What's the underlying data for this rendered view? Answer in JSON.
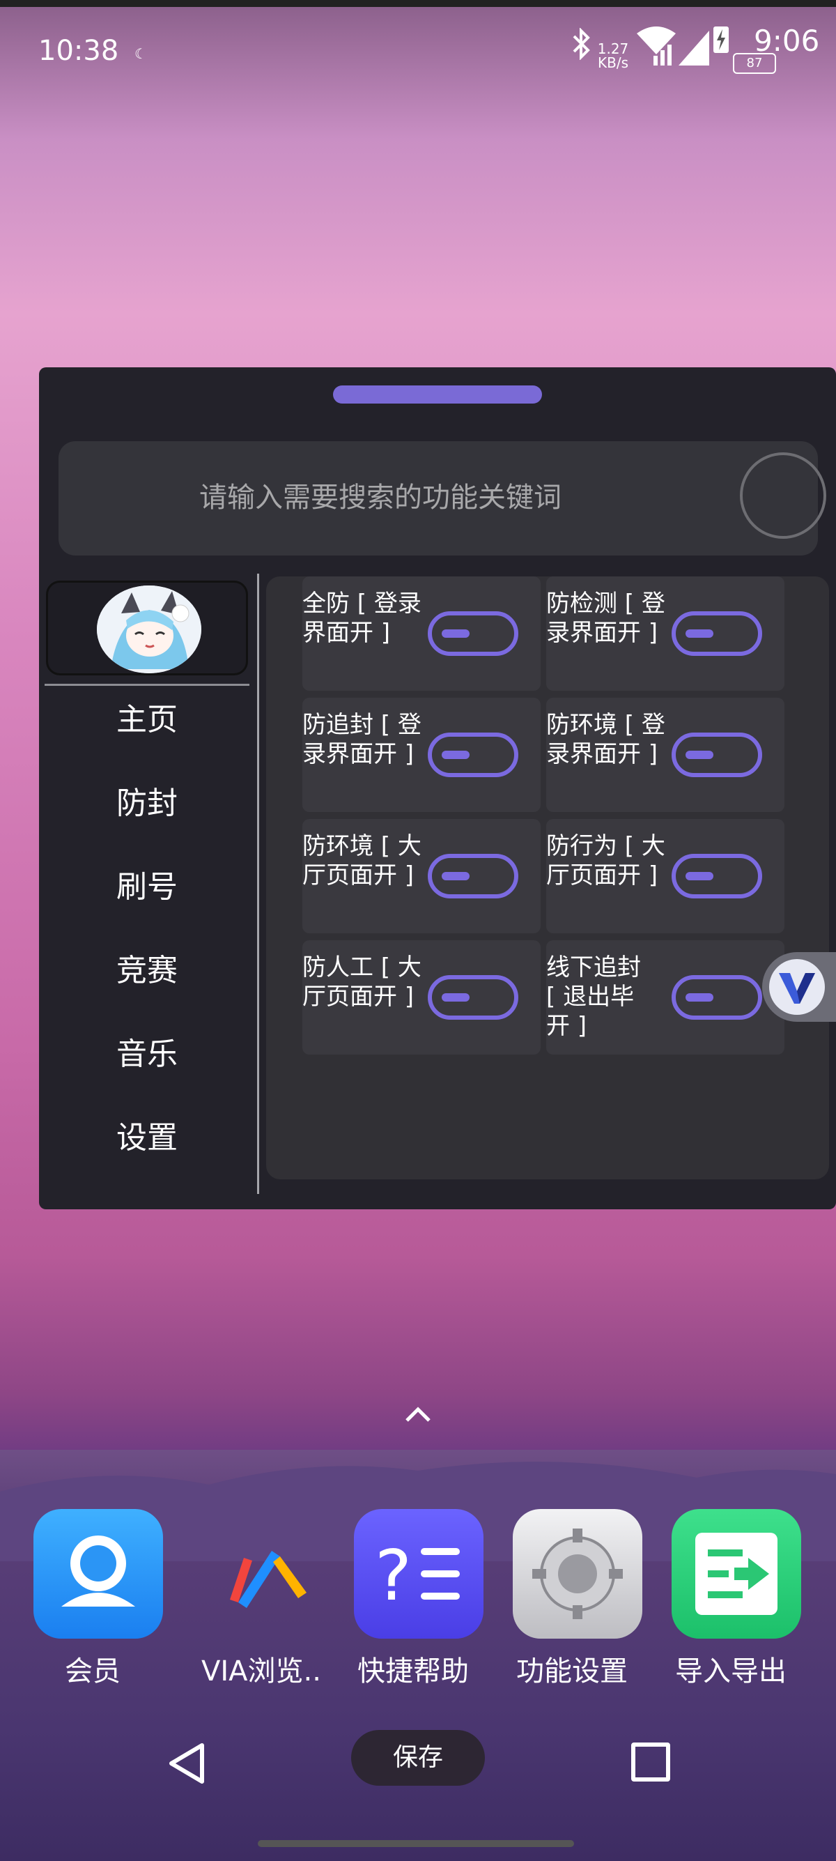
{
  "status_bar": {
    "time": "10:38",
    "secondary_time": "9:06",
    "net_speed_value": "1.27",
    "net_speed_unit": "KB/s",
    "battery": "87",
    "icons": [
      "bluetooth-icon",
      "wifi-icon",
      "signal-icon",
      "charging-icon"
    ]
  },
  "panel": {
    "search": {
      "placeholder": "请输入需要搜索的功能关键词"
    },
    "sidebar": {
      "items": [
        {
          "label": "主页"
        },
        {
          "label": "防封"
        },
        {
          "label": "刷号"
        },
        {
          "label": "竞赛"
        },
        {
          "label": "音乐"
        },
        {
          "label": "设置"
        }
      ]
    },
    "toggles": [
      {
        "label": "全防 [ 登录界面开 ]"
      },
      {
        "label": "防检测 [ 登录界面开 ]"
      },
      {
        "label": "防追封 [ 登录界面开 ]"
      },
      {
        "label": "防环境 [ 登录界面开 ]"
      },
      {
        "label": "防环境 [ 大厅页面开 ]"
      },
      {
        "label": "防行为 [ 大厅页面开 ]"
      },
      {
        "label": "防人工 [ 大厅页面开 ]"
      },
      {
        "label": "线下追封 [ 退出毕开 ]"
      }
    ],
    "accent_color": "#7b6ae0"
  },
  "dock": {
    "apps": [
      {
        "label": "会员",
        "icon": "member-icon"
      },
      {
        "label": "VIA浏览..",
        "icon": "via-browser-icon"
      },
      {
        "label": "快捷帮助",
        "icon": "help-icon"
      },
      {
        "label": "功能设置",
        "icon": "settings-gear-icon"
      },
      {
        "label": "导入导出",
        "icon": "import-export-icon"
      }
    ]
  },
  "nav_bar": {
    "save_label": "保存"
  }
}
